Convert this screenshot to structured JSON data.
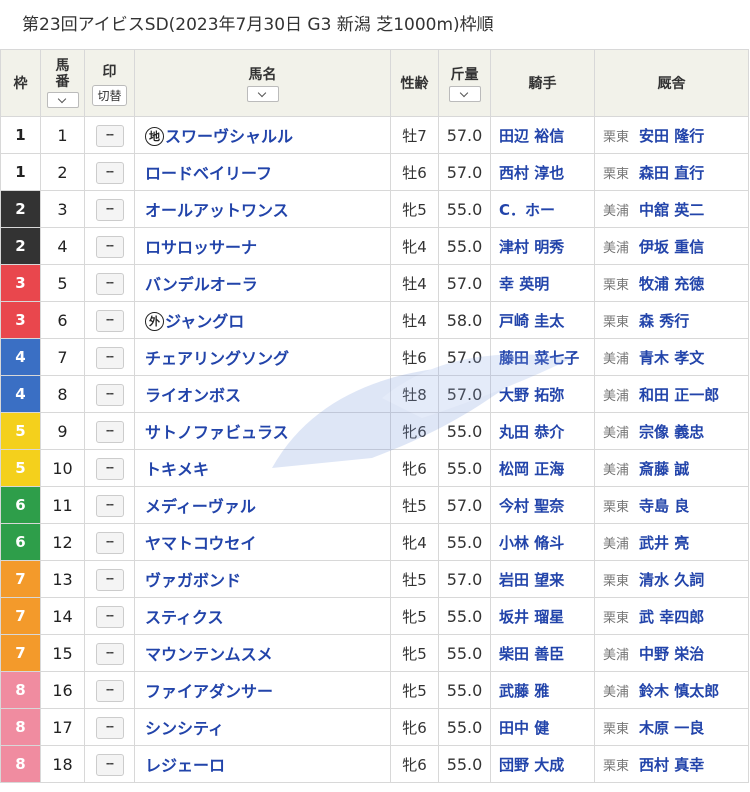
{
  "title": "第23回アイビスSD(2023年7月30日 G3 新潟 芝1000m)枠順",
  "headers": {
    "waku": "枠",
    "umaban": "馬番",
    "mark": "印",
    "mark_toggle": "切替",
    "horse": "馬名",
    "sexage": "性齢",
    "weight": "斤量",
    "jockey": "騎手",
    "stable": "厩舎"
  },
  "mark_placeholder": "--",
  "waku_colors": {
    "1": {
      "bg": "#ffffff",
      "fg": "#222222"
    },
    "2": {
      "bg": "#333333",
      "fg": "#ffffff"
    },
    "3": {
      "bg": "#e9474d",
      "fg": "#ffffff"
    },
    "4": {
      "bg": "#3a6fc4",
      "fg": "#ffffff"
    },
    "5": {
      "bg": "#f4d01c",
      "fg": "#ffffff"
    },
    "6": {
      "bg": "#2e9e4a",
      "fg": "#ffffff"
    },
    "7": {
      "bg": "#f39a2b",
      "fg": "#ffffff"
    },
    "8": {
      "bg": "#f08ca0",
      "fg": "#ffffff"
    }
  },
  "rows": [
    {
      "waku": "1",
      "umaban": "1",
      "badge": "地",
      "horse": "スワーヴシャルル",
      "sexage": "牡7",
      "weight": "57.0",
      "jockey": "田辺 裕信",
      "region": "栗東",
      "trainer": "安田 隆行"
    },
    {
      "waku": "1",
      "umaban": "2",
      "badge": "",
      "horse": "ロードベイリーフ",
      "sexage": "牡6",
      "weight": "57.0",
      "jockey": "西村 淳也",
      "region": "栗東",
      "trainer": "森田 直行"
    },
    {
      "waku": "2",
      "umaban": "3",
      "badge": "",
      "horse": "オールアットワンス",
      "sexage": "牝5",
      "weight": "55.0",
      "jockey": "C．ホー",
      "region": "美浦",
      "trainer": "中舘 英二"
    },
    {
      "waku": "2",
      "umaban": "4",
      "badge": "",
      "horse": "ロサロッサーナ",
      "sexage": "牝4",
      "weight": "55.0",
      "jockey": "津村 明秀",
      "region": "美浦",
      "trainer": "伊坂 重信"
    },
    {
      "waku": "3",
      "umaban": "5",
      "badge": "",
      "horse": "バンデルオーラ",
      "sexage": "牡4",
      "weight": "57.0",
      "jockey": "幸 英明",
      "region": "栗東",
      "trainer": "牧浦 充徳"
    },
    {
      "waku": "3",
      "umaban": "6",
      "badge": "外",
      "horse": "ジャングロ",
      "sexage": "牡4",
      "weight": "58.0",
      "jockey": "戸崎 圭太",
      "region": "栗東",
      "trainer": "森 秀行"
    },
    {
      "waku": "4",
      "umaban": "7",
      "badge": "",
      "horse": "チェアリングソング",
      "sexage": "牡6",
      "weight": "57.0",
      "jockey": "藤田 菜七子",
      "region": "美浦",
      "trainer": "青木 孝文"
    },
    {
      "waku": "4",
      "umaban": "8",
      "badge": "",
      "horse": "ライオンボス",
      "sexage": "牡8",
      "weight": "57.0",
      "jockey": "大野 拓弥",
      "region": "美浦",
      "trainer": "和田 正一郎"
    },
    {
      "waku": "5",
      "umaban": "9",
      "badge": "",
      "horse": "サトノファビュラス",
      "sexage": "牝6",
      "weight": "55.0",
      "jockey": "丸田 恭介",
      "region": "美浦",
      "trainer": "宗像 義忠"
    },
    {
      "waku": "5",
      "umaban": "10",
      "badge": "",
      "horse": "トキメキ",
      "sexage": "牝6",
      "weight": "55.0",
      "jockey": "松岡 正海",
      "region": "美浦",
      "trainer": "斎藤 誠"
    },
    {
      "waku": "6",
      "umaban": "11",
      "badge": "",
      "horse": "メディーヴァル",
      "sexage": "牡5",
      "weight": "57.0",
      "jockey": "今村 聖奈",
      "region": "栗東",
      "trainer": "寺島 良"
    },
    {
      "waku": "6",
      "umaban": "12",
      "badge": "",
      "horse": "ヤマトコウセイ",
      "sexage": "牝4",
      "weight": "55.0",
      "jockey": "小林 脩斗",
      "region": "美浦",
      "trainer": "武井 亮"
    },
    {
      "waku": "7",
      "umaban": "13",
      "badge": "",
      "horse": "ヴァガボンド",
      "sexage": "牡5",
      "weight": "57.0",
      "jockey": "岩田 望来",
      "region": "栗東",
      "trainer": "清水 久詞"
    },
    {
      "waku": "7",
      "umaban": "14",
      "badge": "",
      "horse": "スティクス",
      "sexage": "牝5",
      "weight": "55.0",
      "jockey": "坂井 瑠星",
      "region": "栗東",
      "trainer": "武 幸四郎"
    },
    {
      "waku": "7",
      "umaban": "15",
      "badge": "",
      "horse": "マウンテンムスメ",
      "sexage": "牝5",
      "weight": "55.0",
      "jockey": "柴田 善臣",
      "region": "美浦",
      "trainer": "中野 栄治"
    },
    {
      "waku": "8",
      "umaban": "16",
      "badge": "",
      "horse": "ファイアダンサー",
      "sexage": "牝5",
      "weight": "55.0",
      "jockey": "武藤 雅",
      "region": "美浦",
      "trainer": "鈴木 慎太郎"
    },
    {
      "waku": "8",
      "umaban": "17",
      "badge": "",
      "horse": "シンシティ",
      "sexage": "牝6",
      "weight": "55.0",
      "jockey": "田中 健",
      "region": "栗東",
      "trainer": "木原 一良"
    },
    {
      "waku": "8",
      "umaban": "18",
      "badge": "",
      "horse": "レジェーロ",
      "sexage": "牝6",
      "weight": "55.0",
      "jockey": "団野 大成",
      "region": "栗東",
      "trainer": "西村 真幸"
    }
  ]
}
